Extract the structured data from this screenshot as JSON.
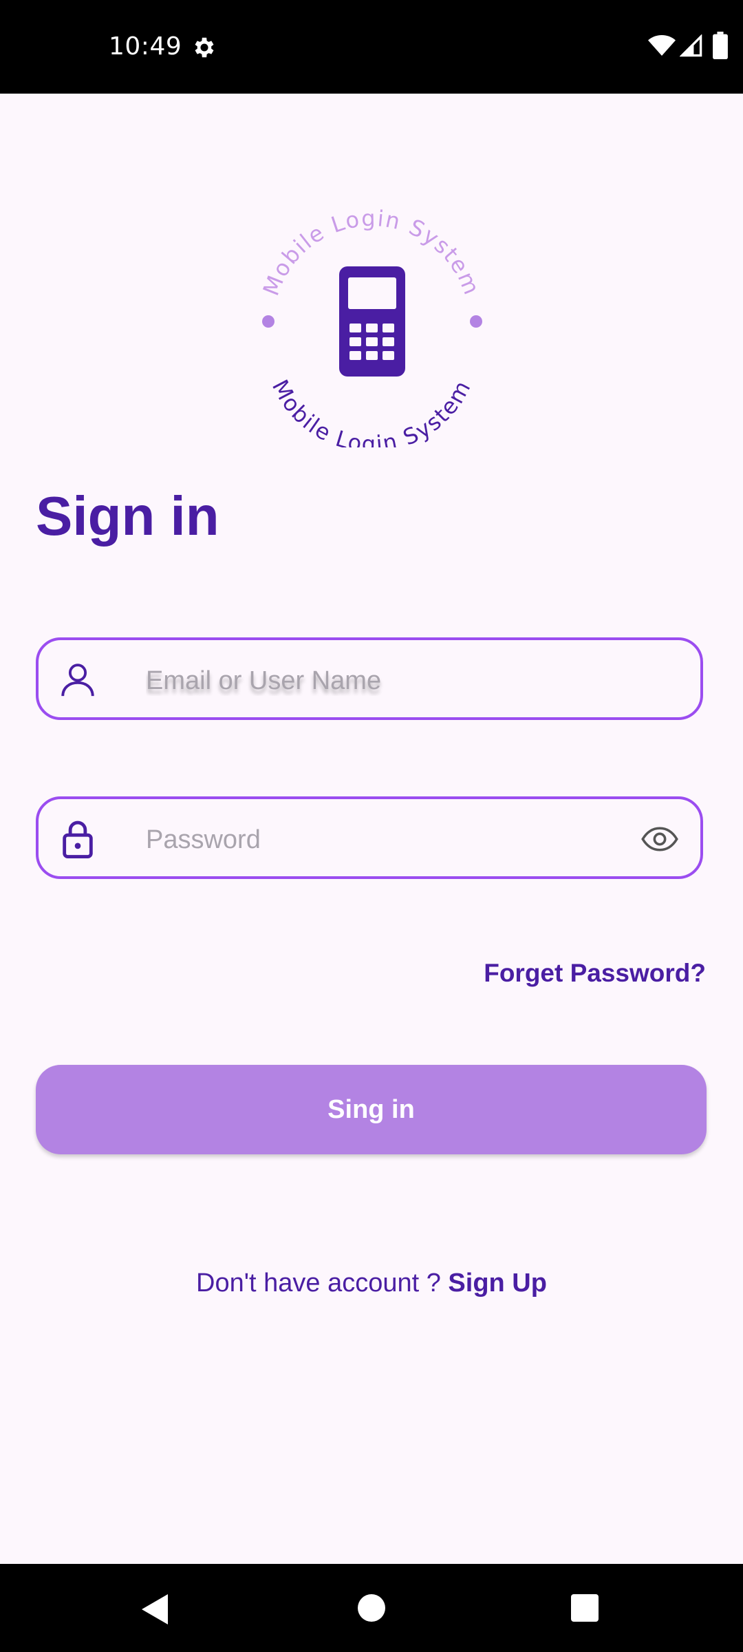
{
  "status_bar": {
    "time": "10:49",
    "icons": [
      "gear-icon",
      "wifi-icon",
      "signal-icon",
      "battery-icon"
    ]
  },
  "logo": {
    "text_top": "Mobile Login System",
    "text_bottom": "Mobile Login System",
    "icon": "phone-keypad-icon"
  },
  "page": {
    "title": "Sign in"
  },
  "form": {
    "email": {
      "placeholder": "Email or User Name",
      "value": "",
      "icon": "user-icon"
    },
    "password": {
      "placeholder": "Password",
      "value": "",
      "icon": "lock-icon",
      "toggle_icon": "eye-icon"
    },
    "forgot_label": "Forget Password?",
    "submit_label": "Sing in"
  },
  "footer": {
    "prompt": "Don't have account ? ",
    "signup_label": "Sign Up"
  },
  "nav_bar": {
    "icons": [
      "back-icon",
      "home-icon",
      "recents-icon"
    ]
  },
  "colors": {
    "accent": "#4a1ea3",
    "field_border": "#9b4df0",
    "button": "#b383e3",
    "logo_light": "#c99be8",
    "background": "#fdf7fd"
  }
}
